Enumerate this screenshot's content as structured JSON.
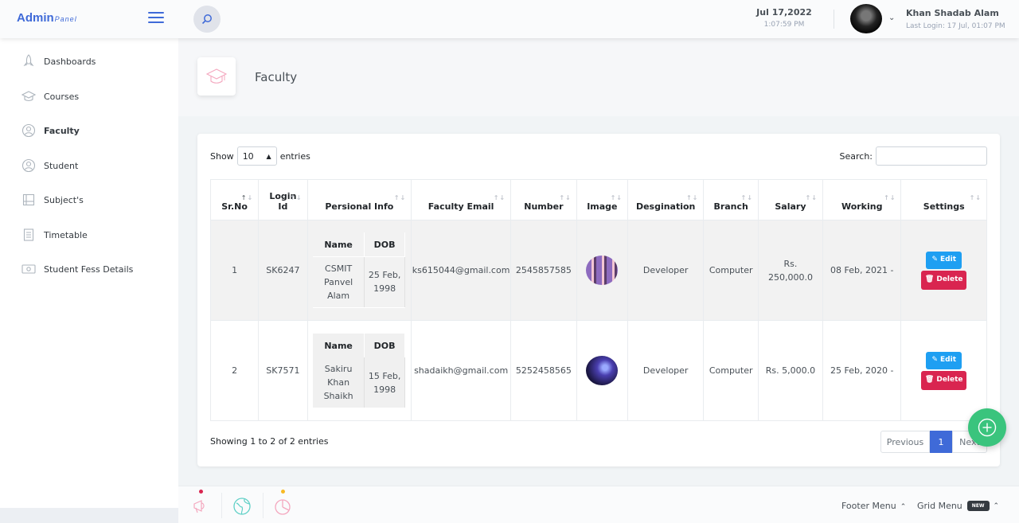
{
  "header": {
    "logo_main": "Admin",
    "logo_sub": "Panel",
    "date": "Jul 17,2022",
    "time": "1:07:59 PM",
    "user_name": "Khan Shadab Alam",
    "last_login": "Last Login: 17 Jul, 01:07 PM"
  },
  "sidebar": {
    "items": [
      {
        "label": "Dashboards",
        "icon": "rocket-icon"
      },
      {
        "label": "Courses",
        "icon": "graduation-cap-icon"
      },
      {
        "label": "Faculty",
        "icon": "user-circle-icon"
      },
      {
        "label": "Student",
        "icon": "user-circle-icon"
      },
      {
        "label": "Subject's",
        "icon": "notebook-icon"
      },
      {
        "label": "Timetable",
        "icon": "document-icon"
      },
      {
        "label": "Student Fess Details",
        "icon": "wallet-icon"
      }
    ]
  },
  "page": {
    "title": "Faculty"
  },
  "table_controls": {
    "show_label": "Show",
    "entries_value": "10",
    "entries_label": "entries",
    "search_label": "Search:"
  },
  "table": {
    "columns": [
      "Sr.No",
      "Login Id",
      "Persional Info",
      "Faculty Email",
      "Number",
      "Image",
      "Desgination",
      "Branch",
      "Salary",
      "Working",
      "Settings"
    ],
    "inner_headers": [
      "Name",
      "DOB"
    ],
    "rows": [
      {
        "sr": "1",
        "login": "SK6247",
        "name": "CSMIT Panvel Alam",
        "dob": "25 Feb, 1998",
        "email": "ks615044@gmail.com",
        "number": "2545857585",
        "designation": "Developer",
        "branch": "Computer",
        "salary": "Rs. 250,000.0",
        "working": "08 Feb, 2021 -"
      },
      {
        "sr": "2",
        "login": "SK7571",
        "name": "Sakiru Khan Shaikh",
        "dob": "15 Feb, 1998",
        "email": "shadaikh@gmail.com",
        "number": "5252458565",
        "designation": "Developer",
        "branch": "Computer",
        "salary": "Rs. 5,000.0",
        "working": "25 Feb, 2020 -"
      }
    ],
    "edit_label": "Edit",
    "delete_label": "Delete"
  },
  "pagination": {
    "info": "Showing 1 to 2 of 2 entries",
    "previous": "Previous",
    "page": "1",
    "next": "Next"
  },
  "footer": {
    "footer_menu": "Footer Menu",
    "grid_menu": "Grid Menu",
    "badge": "NEW"
  },
  "colors": {
    "primary": "#3f6ad8",
    "success": "#3ac47d",
    "danger": "#d92550",
    "info": "#1e9ff2"
  }
}
